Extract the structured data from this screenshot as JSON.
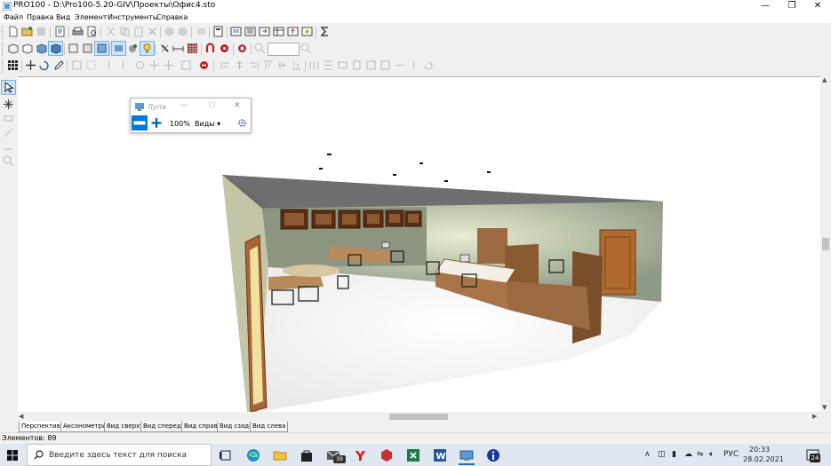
{
  "window": {
    "title": "PRO100 - D:\\Pro100-5.20-GIV\\Проекты\\Офис4.sto",
    "controls": {
      "minimize": "—",
      "maximize": "❐",
      "close": "✕"
    }
  },
  "menu": [
    "Файл",
    "Правка",
    "Вид",
    "Элемент",
    "Инструменты",
    "Справка"
  ],
  "magnifier_window": {
    "title": "Лупа",
    "zoom": "100%",
    "views_label": "Виды",
    "controls": {
      "minimize": "—",
      "maximize": "☐",
      "close": "✕"
    }
  },
  "view_tabs": [
    "Перспектива",
    "Аксонометрия",
    "Вид сверху",
    "Вид спереди",
    "Вид справа",
    "Вид сзади",
    "Вид слева"
  ],
  "active_tab": "Перспектива",
  "status": {
    "elements": "Элементов: 89"
  },
  "taskbar": {
    "search_placeholder": "Введите здесь текст для поиска",
    "mail_badge": "39",
    "lang": "РУС",
    "time": "20:33",
    "date": "28.02.2021",
    "notification_count": "24"
  },
  "colors": {
    "accent": "#0078d7",
    "window_bg": "#f0f0f0",
    "taskbar": "#dfe8f1"
  }
}
